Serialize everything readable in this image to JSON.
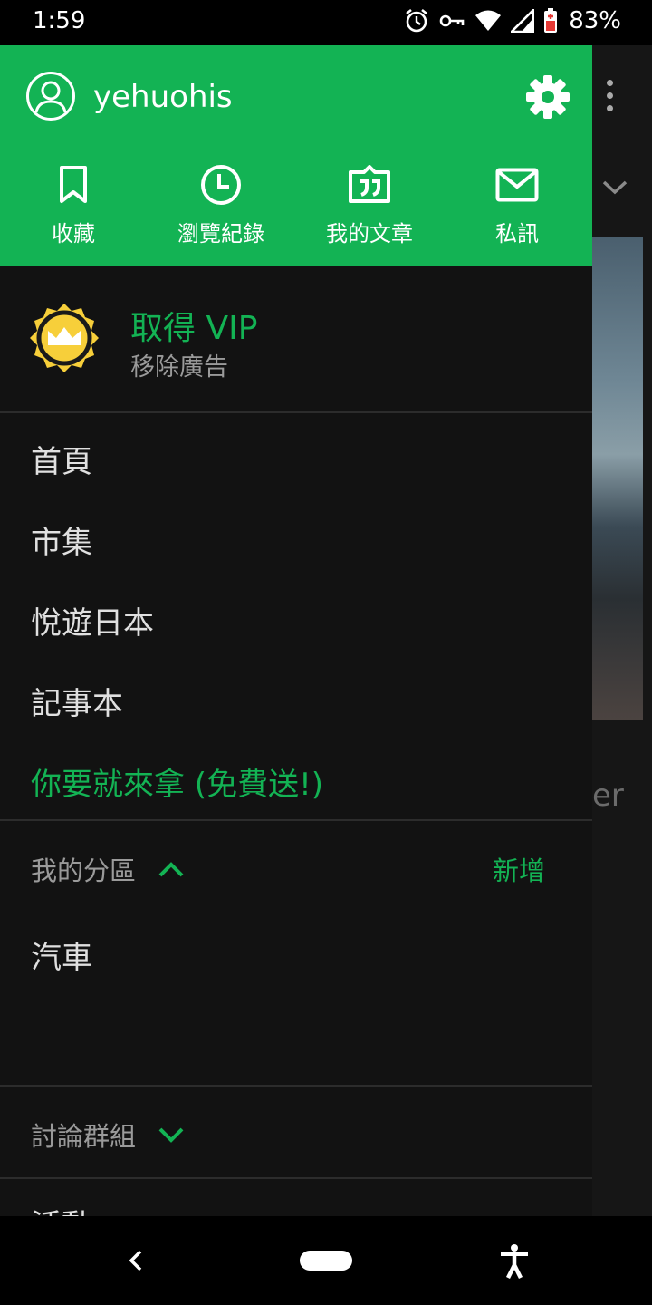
{
  "status_bar": {
    "time": "1:59",
    "battery": "83%",
    "icons": [
      "alarm-icon",
      "vpn-key-icon",
      "wifi-icon",
      "signal-icon",
      "battery-icon"
    ]
  },
  "drawer": {
    "username": "yehuohis",
    "quick_actions": [
      {
        "label": "收藏",
        "icon": "bookmark-icon"
      },
      {
        "label": "瀏覽紀錄",
        "icon": "clock-icon"
      },
      {
        "label": "我的文章",
        "icon": "article-icon"
      },
      {
        "label": "私訊",
        "icon": "mail-icon"
      }
    ],
    "vip": {
      "title": "取得 VIP",
      "subtitle": "移除廣告"
    },
    "menu": [
      "首頁",
      "市集",
      "悅遊日本",
      "記事本"
    ],
    "promo": "你要就來拿 (免費送!)",
    "my_sections": {
      "title": "我的分區",
      "add_label": "新增",
      "items": [
        "汽車"
      ]
    },
    "groups": {
      "title": "討論群組"
    },
    "partial_item": "活動"
  },
  "background": {
    "partial_text": "er"
  },
  "colors": {
    "accent": "#13b354",
    "drawer_bg": "#121212",
    "vip_gold": "#f7cf3a"
  }
}
